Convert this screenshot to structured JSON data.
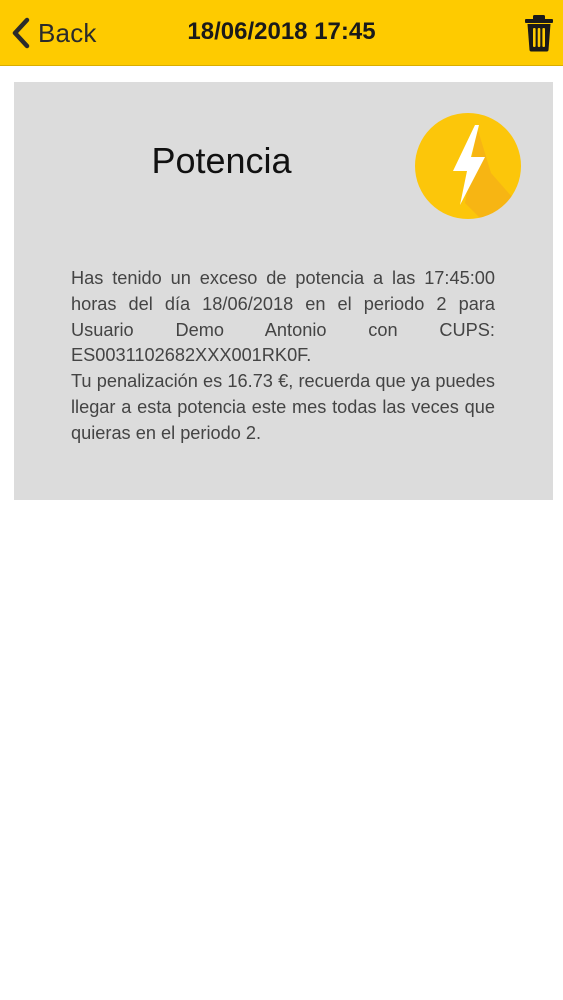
{
  "header": {
    "back_label": "Back",
    "title": "18/06/2018 17:45",
    "accent_color": "#fecb00"
  },
  "notification": {
    "title": "Potencia",
    "icon": "lightning-icon",
    "paragraph1": "Has tenido un exceso de potencia a las 17:45:00 horas del día 18/06/2018 en el periodo 2 para Usuario Demo Antonio con CUPS: ES0031102682XXX001RK0F.",
    "paragraph2": "Tu penalización es 16.73 €, recuerda que ya puedes llegar a esta potencia este mes todas las veces que quieras en el periodo 2."
  }
}
